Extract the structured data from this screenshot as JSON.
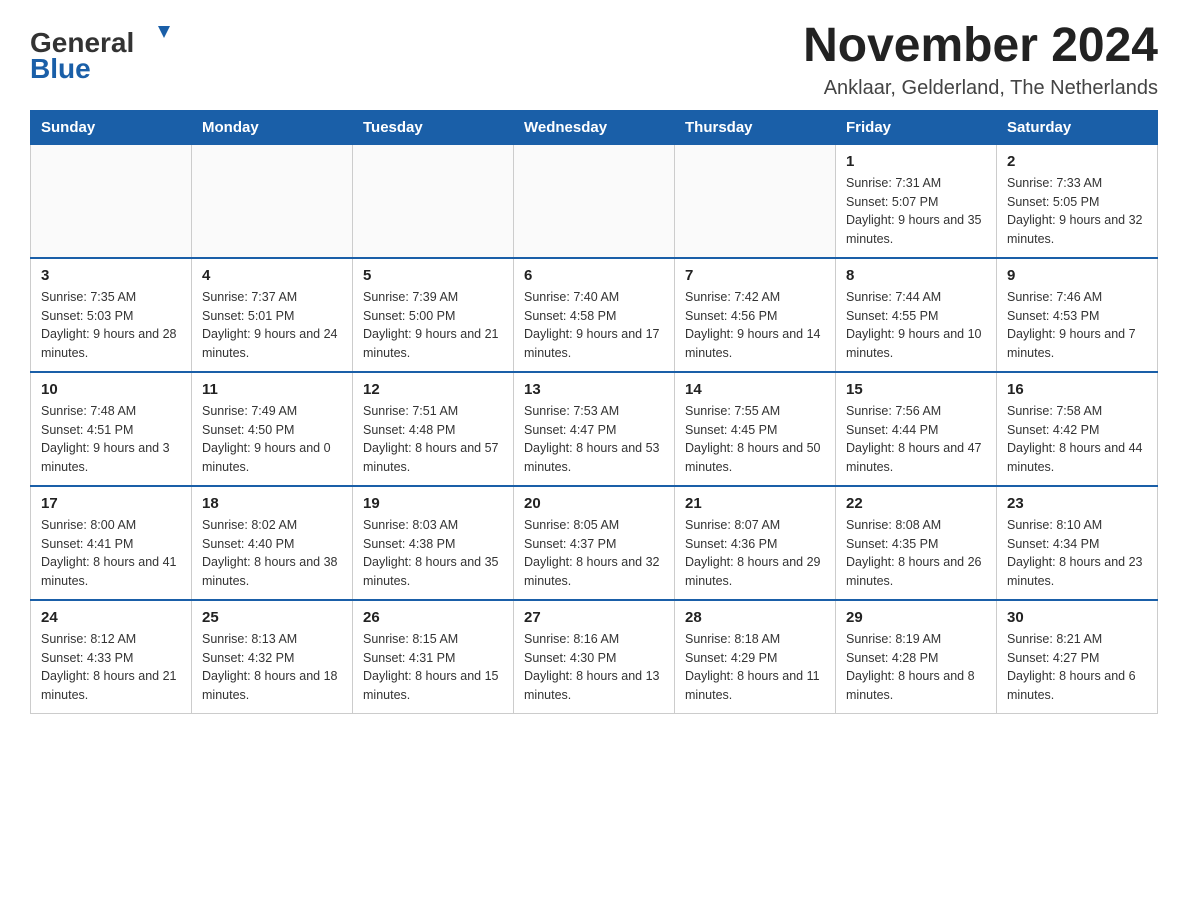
{
  "header": {
    "logo_general": "General",
    "logo_blue": "Blue",
    "month_title": "November 2024",
    "location": "Anklaar, Gelderland, The Netherlands"
  },
  "days_of_week": [
    "Sunday",
    "Monday",
    "Tuesday",
    "Wednesday",
    "Thursday",
    "Friday",
    "Saturday"
  ],
  "weeks": [
    [
      {
        "day": "",
        "info": ""
      },
      {
        "day": "",
        "info": ""
      },
      {
        "day": "",
        "info": ""
      },
      {
        "day": "",
        "info": ""
      },
      {
        "day": "",
        "info": ""
      },
      {
        "day": "1",
        "info": "Sunrise: 7:31 AM\nSunset: 5:07 PM\nDaylight: 9 hours\nand 35 minutes."
      },
      {
        "day": "2",
        "info": "Sunrise: 7:33 AM\nSunset: 5:05 PM\nDaylight: 9 hours\nand 32 minutes."
      }
    ],
    [
      {
        "day": "3",
        "info": "Sunrise: 7:35 AM\nSunset: 5:03 PM\nDaylight: 9 hours\nand 28 minutes."
      },
      {
        "day": "4",
        "info": "Sunrise: 7:37 AM\nSunset: 5:01 PM\nDaylight: 9 hours\nand 24 minutes."
      },
      {
        "day": "5",
        "info": "Sunrise: 7:39 AM\nSunset: 5:00 PM\nDaylight: 9 hours\nand 21 minutes."
      },
      {
        "day": "6",
        "info": "Sunrise: 7:40 AM\nSunset: 4:58 PM\nDaylight: 9 hours\nand 17 minutes."
      },
      {
        "day": "7",
        "info": "Sunrise: 7:42 AM\nSunset: 4:56 PM\nDaylight: 9 hours\nand 14 minutes."
      },
      {
        "day": "8",
        "info": "Sunrise: 7:44 AM\nSunset: 4:55 PM\nDaylight: 9 hours\nand 10 minutes."
      },
      {
        "day": "9",
        "info": "Sunrise: 7:46 AM\nSunset: 4:53 PM\nDaylight: 9 hours\nand 7 minutes."
      }
    ],
    [
      {
        "day": "10",
        "info": "Sunrise: 7:48 AM\nSunset: 4:51 PM\nDaylight: 9 hours\nand 3 minutes."
      },
      {
        "day": "11",
        "info": "Sunrise: 7:49 AM\nSunset: 4:50 PM\nDaylight: 9 hours\nand 0 minutes."
      },
      {
        "day": "12",
        "info": "Sunrise: 7:51 AM\nSunset: 4:48 PM\nDaylight: 8 hours\nand 57 minutes."
      },
      {
        "day": "13",
        "info": "Sunrise: 7:53 AM\nSunset: 4:47 PM\nDaylight: 8 hours\nand 53 minutes."
      },
      {
        "day": "14",
        "info": "Sunrise: 7:55 AM\nSunset: 4:45 PM\nDaylight: 8 hours\nand 50 minutes."
      },
      {
        "day": "15",
        "info": "Sunrise: 7:56 AM\nSunset: 4:44 PM\nDaylight: 8 hours\nand 47 minutes."
      },
      {
        "day": "16",
        "info": "Sunrise: 7:58 AM\nSunset: 4:42 PM\nDaylight: 8 hours\nand 44 minutes."
      }
    ],
    [
      {
        "day": "17",
        "info": "Sunrise: 8:00 AM\nSunset: 4:41 PM\nDaylight: 8 hours\nand 41 minutes."
      },
      {
        "day": "18",
        "info": "Sunrise: 8:02 AM\nSunset: 4:40 PM\nDaylight: 8 hours\nand 38 minutes."
      },
      {
        "day": "19",
        "info": "Sunrise: 8:03 AM\nSunset: 4:38 PM\nDaylight: 8 hours\nand 35 minutes."
      },
      {
        "day": "20",
        "info": "Sunrise: 8:05 AM\nSunset: 4:37 PM\nDaylight: 8 hours\nand 32 minutes."
      },
      {
        "day": "21",
        "info": "Sunrise: 8:07 AM\nSunset: 4:36 PM\nDaylight: 8 hours\nand 29 minutes."
      },
      {
        "day": "22",
        "info": "Sunrise: 8:08 AM\nSunset: 4:35 PM\nDaylight: 8 hours\nand 26 minutes."
      },
      {
        "day": "23",
        "info": "Sunrise: 8:10 AM\nSunset: 4:34 PM\nDaylight: 8 hours\nand 23 minutes."
      }
    ],
    [
      {
        "day": "24",
        "info": "Sunrise: 8:12 AM\nSunset: 4:33 PM\nDaylight: 8 hours\nand 21 minutes."
      },
      {
        "day": "25",
        "info": "Sunrise: 8:13 AM\nSunset: 4:32 PM\nDaylight: 8 hours\nand 18 minutes."
      },
      {
        "day": "26",
        "info": "Sunrise: 8:15 AM\nSunset: 4:31 PM\nDaylight: 8 hours\nand 15 minutes."
      },
      {
        "day": "27",
        "info": "Sunrise: 8:16 AM\nSunset: 4:30 PM\nDaylight: 8 hours\nand 13 minutes."
      },
      {
        "day": "28",
        "info": "Sunrise: 8:18 AM\nSunset: 4:29 PM\nDaylight: 8 hours\nand 11 minutes."
      },
      {
        "day": "29",
        "info": "Sunrise: 8:19 AM\nSunset: 4:28 PM\nDaylight: 8 hours\nand 8 minutes."
      },
      {
        "day": "30",
        "info": "Sunrise: 8:21 AM\nSunset: 4:27 PM\nDaylight: 8 hours\nand 6 minutes."
      }
    ]
  ]
}
